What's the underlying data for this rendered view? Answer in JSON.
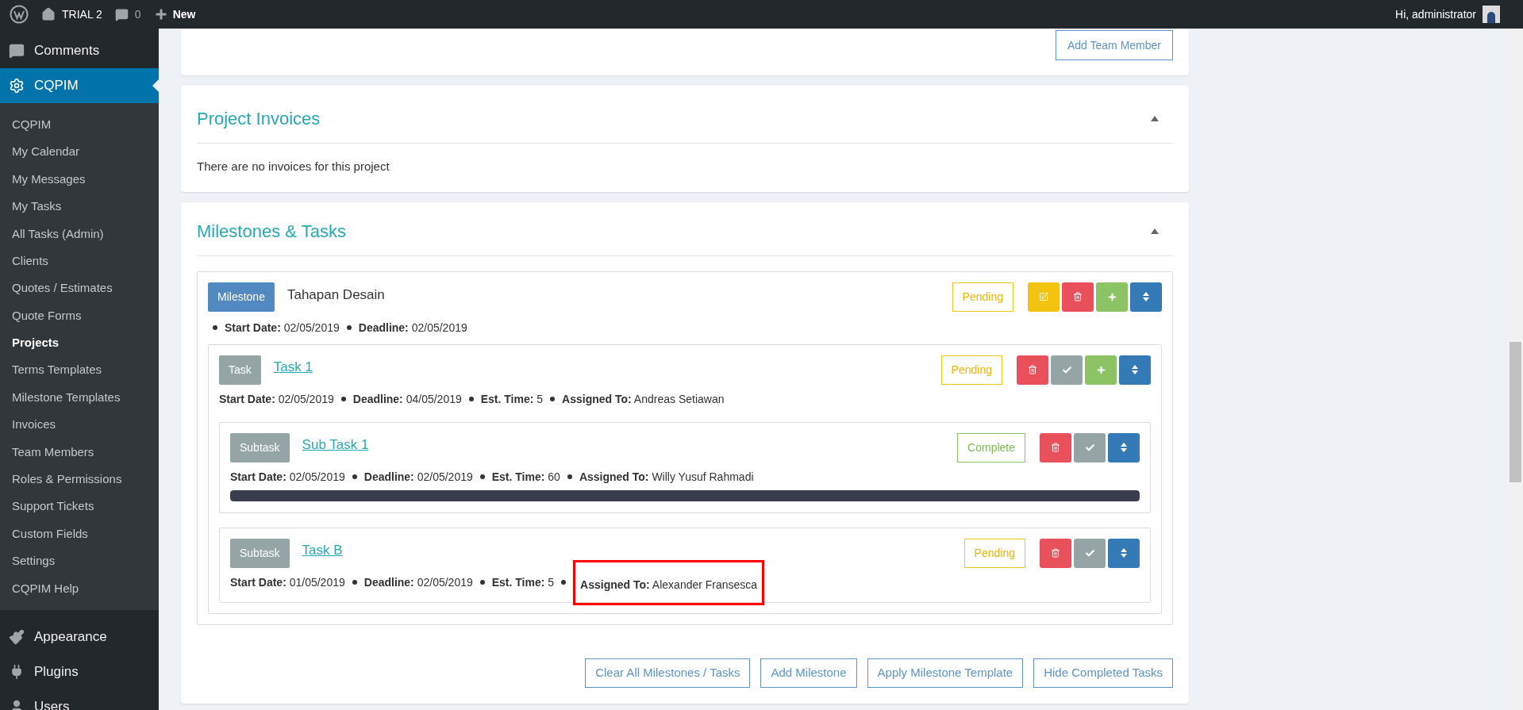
{
  "admin_bar": {
    "site": "TRIAL 2",
    "comments": "0",
    "new": "New",
    "greeting": "Hi, administrator"
  },
  "sidebar": {
    "items": [
      {
        "label": "Comments",
        "selected": false
      },
      {
        "label": "CQPIM",
        "selected": true,
        "children": [
          {
            "label": "CQPIM",
            "selected": false
          },
          {
            "label": "My Calendar",
            "selected": false
          },
          {
            "label": "My Messages",
            "selected": false
          },
          {
            "label": "My Tasks",
            "selected": false
          },
          {
            "label": "All Tasks (Admin)",
            "selected": false
          },
          {
            "label": "Clients",
            "selected": false
          },
          {
            "label": "Quotes / Estimates",
            "selected": false
          },
          {
            "label": "Quote Forms",
            "selected": false
          },
          {
            "label": "Projects",
            "selected": true
          },
          {
            "label": "Terms Templates",
            "selected": false
          },
          {
            "label": "Milestone Templates",
            "selected": false
          },
          {
            "label": "Invoices",
            "selected": false
          },
          {
            "label": "Team Members",
            "selected": false
          },
          {
            "label": "Roles & Permissions",
            "selected": false
          },
          {
            "label": "Support Tickets",
            "selected": false
          },
          {
            "label": "Custom Fields",
            "selected": false
          },
          {
            "label": "Settings",
            "selected": false
          },
          {
            "label": "CQPIM Help",
            "selected": false
          }
        ]
      },
      {
        "label": "Appearance",
        "selected": false
      },
      {
        "label": "Plugins",
        "selected": false
      },
      {
        "label": "Users",
        "selected": false
      }
    ]
  },
  "team_card": {
    "button": "Add Team Member"
  },
  "invoices": {
    "title": "Project Invoices",
    "empty": "There are no invoices for this project"
  },
  "milestones": {
    "title": "Milestones & Tasks",
    "items": [
      {
        "badge": "Milestone",
        "name": "Tahapan Desain",
        "status": "Pending",
        "complete": false,
        "actions": [
          {
            "kind": "edit"
          },
          {
            "kind": "delete"
          },
          {
            "kind": "add"
          },
          {
            "kind": "sort"
          }
        ],
        "meta": [
          {
            "label": "Start Date:",
            "value": "02/05/2019",
            "highlighted": false
          },
          {
            "label": "Deadline:",
            "value": "02/05/2019",
            "highlighted": false
          }
        ],
        "tasks": [
          {
            "badge": "Task",
            "name": "Task 1",
            "status": "Pending",
            "complete": false,
            "actions": [
              {
                "kind": "delete"
              },
              {
                "kind": "check"
              },
              {
                "kind": "add"
              },
              {
                "kind": "sort"
              }
            ],
            "meta": [
              {
                "label": "Start Date:",
                "value": "02/05/2019",
                "highlighted": false
              },
              {
                "label": "Deadline:",
                "value": "04/05/2019",
                "highlighted": false
              },
              {
                "label": "Est. Time:",
                "value": "5",
                "highlighted": false
              },
              {
                "label": "Assigned To:",
                "value": "Andreas Setiawan",
                "highlighted": false
              }
            ],
            "subtasks": [
              {
                "badge": "Subtask",
                "name": "Sub Task 1",
                "status": "Complete",
                "complete": true,
                "progress": {
                  "level": 1
                },
                "actions": [
                  {
                    "kind": "delete"
                  },
                  {
                    "kind": "check"
                  },
                  {
                    "kind": "sort"
                  }
                ],
                "meta": [
                  {
                    "label": "Start Date:",
                    "value": "02/05/2019",
                    "highlighted": false
                  },
                  {
                    "label": "Deadline:",
                    "value": "02/05/2019",
                    "highlighted": false
                  },
                  {
                    "label": "Est. Time:",
                    "value": "60",
                    "highlighted": false
                  },
                  {
                    "label": "Assigned To:",
                    "value": "Willy Yusuf Rahmadi",
                    "highlighted": false
                  }
                ]
              },
              {
                "badge": "Subtask",
                "name": "Task B",
                "status": "Pending",
                "complete": false,
                "actions": [
                  {
                    "kind": "delete"
                  },
                  {
                    "kind": "check"
                  },
                  {
                    "kind": "sort"
                  }
                ],
                "meta": [
                  {
                    "label": "Start Date:",
                    "value": "01/05/2019",
                    "highlighted": false
                  },
                  {
                    "label": "Deadline:",
                    "value": "02/05/2019",
                    "highlighted": false
                  },
                  {
                    "label": "Est. Time:",
                    "value": "5",
                    "highlighted": false
                  },
                  {
                    "label": "Assigned To:",
                    "value": "Alexander Fransesca",
                    "highlighted": true
                  }
                ]
              }
            ]
          }
        ]
      }
    ],
    "buttons": [
      "Clear All Milestones / Tasks",
      "Add Milestone",
      "Apply Milestone Template",
      "Hide Completed Tasks"
    ]
  }
}
